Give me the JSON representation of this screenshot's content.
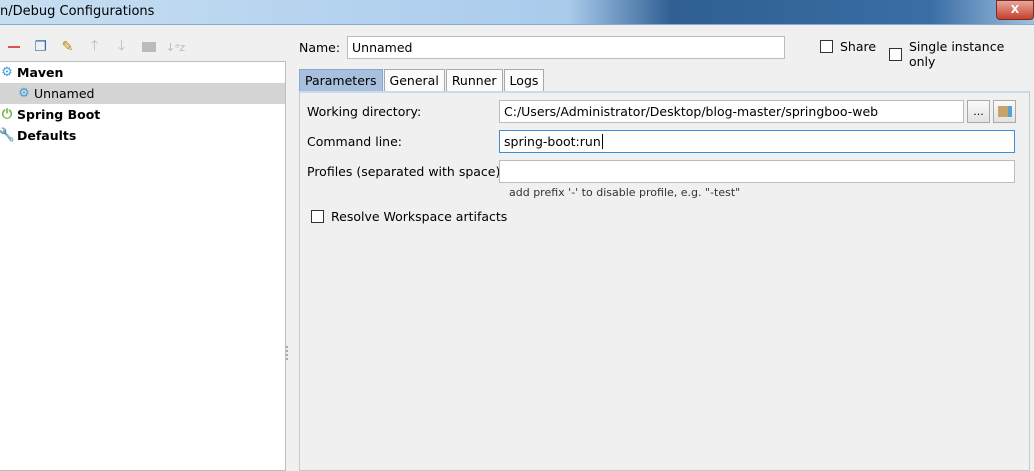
{
  "window": {
    "title": "n/Debug Configurations",
    "close_label": "X"
  },
  "toolbar": {
    "icons": [
      "remove-icon",
      "copy-icon",
      "edit-defaults-icon",
      "move-up-icon",
      "move-down-icon",
      "folder-icon",
      "sort-icon"
    ]
  },
  "tree": {
    "items": [
      {
        "label": "Maven",
        "level": 0,
        "bold": true,
        "icon": "gear-icon"
      },
      {
        "label": "Unnamed",
        "level": 1,
        "bold": false,
        "icon": "gear-icon",
        "selected": true
      },
      {
        "label": "Spring Boot",
        "level": 0,
        "bold": true,
        "icon": "spring-boot-icon"
      },
      {
        "label": "Defaults",
        "level": 0,
        "bold": true,
        "icon": "wrench-icon"
      }
    ]
  },
  "form": {
    "name_label": "Name:",
    "name_value": "Unnamed",
    "share_label": "Share",
    "single_instance_label": "Single instance only",
    "tabs": [
      "Parameters",
      "General",
      "Runner",
      "Logs"
    ],
    "working_dir_label": "Working directory:",
    "working_dir_value": "C:/Users/Administrator/Desktop/blog-master/springboo-web",
    "browse_label": "...",
    "command_line_label": "Command line:",
    "command_line_value": "spring-boot:run",
    "profiles_label": "Profiles (separated with space):",
    "profiles_value": "",
    "profiles_hint": "add prefix '-' to disable profile, e.g. \"-test\"",
    "resolve_label": "Resolve Workspace artifacts"
  }
}
